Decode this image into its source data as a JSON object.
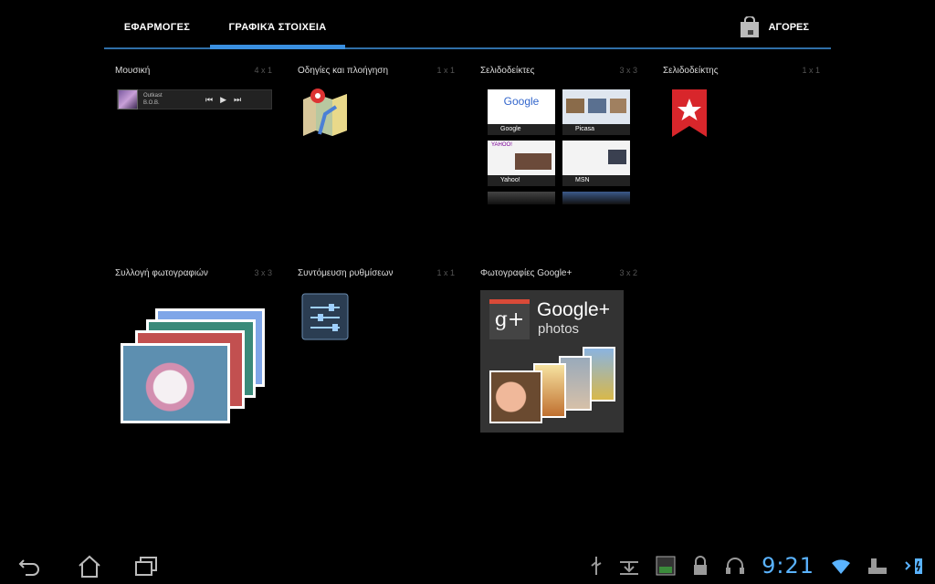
{
  "tabs": {
    "apps": "ΕΦΑΡΜΟΓΕΣ",
    "widgets": "ΓΡΑΦΙΚΆ ΣΤΟΙΧΕΙΑ"
  },
  "store": {
    "label": "ΑΓΟΡΕΣ",
    "icon": "shopping-bag-icon"
  },
  "widgets": [
    {
      "title": "Μουσική",
      "size": "4 x 1"
    },
    {
      "title": "Οδηγίες και πλοήγηση",
      "size": "1 x 1"
    },
    {
      "title": "Σελιδοδείκτες",
      "size": "3 x 3"
    },
    {
      "title": "Σελιδοδείκτης",
      "size": "1 x 1"
    },
    {
      "title": "Συλλογή φωτογραφιών",
      "size": "3 x 3"
    },
    {
      "title": "Συντόμευση ρυθμίσεων",
      "size": "1 x 1"
    },
    {
      "title": "Φωτογραφίες Google+",
      "size": "3 x 2"
    }
  ],
  "music": {
    "artist": "Outkast",
    "album": "B.O.B."
  },
  "bookmarks": [
    "Google",
    "Picasa",
    "Yahoo!",
    "MSN"
  ],
  "gplus": {
    "brand": "Google+",
    "sub": "photos"
  },
  "time": "9:21"
}
